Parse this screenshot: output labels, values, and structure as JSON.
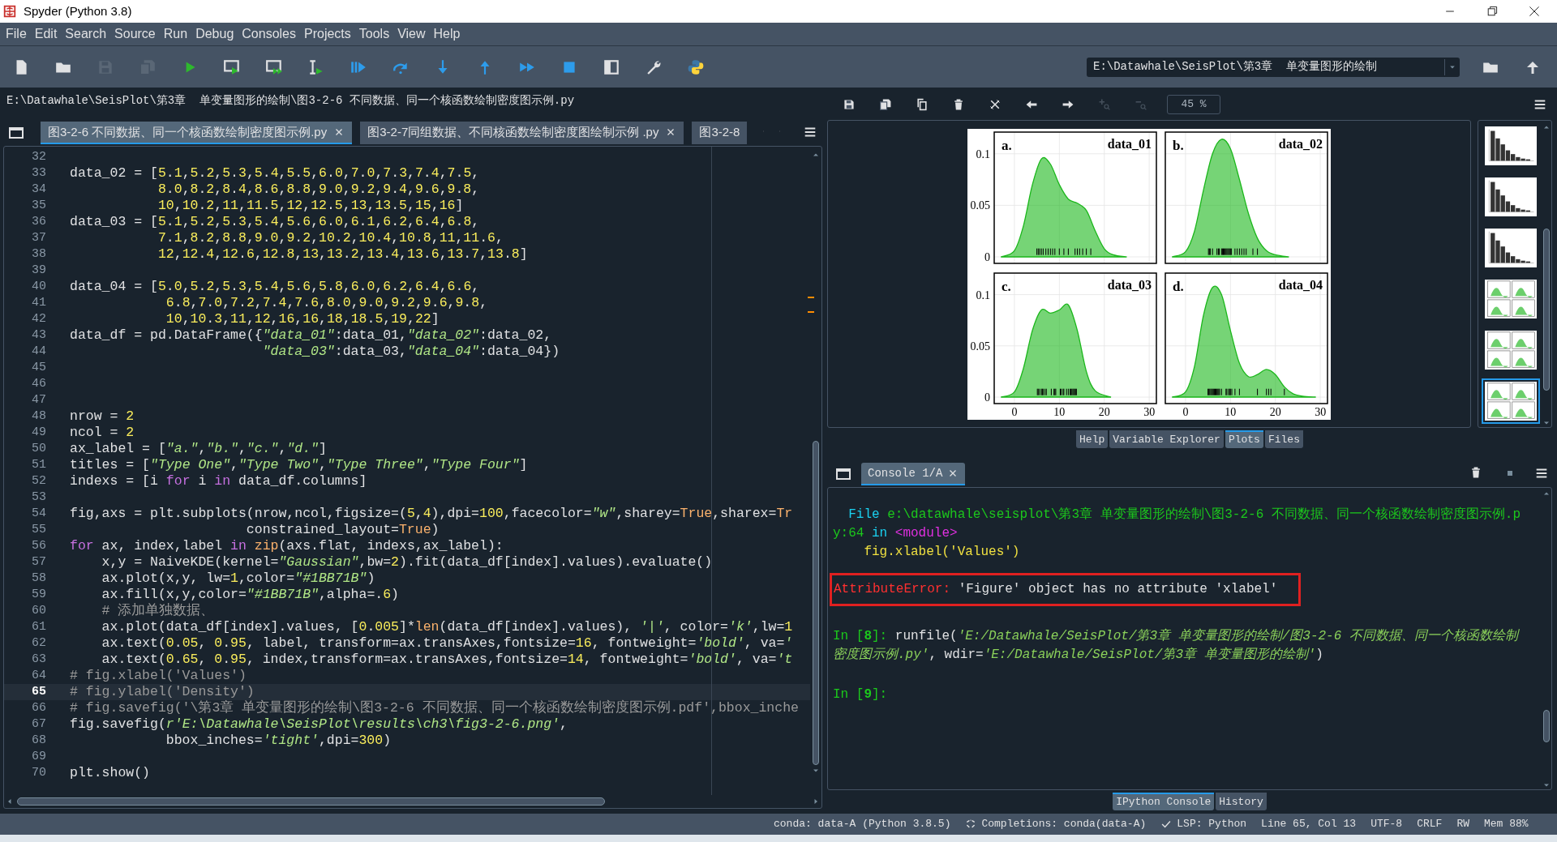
{
  "window": {
    "title": "Spyder (Python 3.8)"
  },
  "menu": [
    "File",
    "Edit",
    "Search",
    "Source",
    "Run",
    "Debug",
    "Consoles",
    "Projects",
    "Tools",
    "View",
    "Help"
  ],
  "toolbar": [
    {
      "kind": "new",
      "disabled": false
    },
    {
      "kind": "open",
      "disabled": false
    },
    {
      "kind": "save",
      "disabled": true
    },
    {
      "kind": "saveall",
      "disabled": true
    },
    {
      "kind": "run",
      "disabled": false
    },
    {
      "kind": "runcell",
      "disabled": false
    },
    {
      "kind": "runcelladvance",
      "disabled": false
    },
    {
      "kind": "runselection",
      "disabled": false
    },
    {
      "kind": "debug",
      "disabled": false
    },
    {
      "kind": "stepover",
      "disabled": false
    },
    {
      "kind": "stepinto",
      "disabled": false
    },
    {
      "kind": "stepout",
      "disabled": false
    },
    {
      "kind": "continue",
      "disabled": false
    },
    {
      "kind": "stop",
      "disabled": false
    },
    {
      "kind": "maximize",
      "disabled": false
    },
    {
      "kind": "preferences",
      "disabled": false
    },
    {
      "kind": "python",
      "disabled": false
    }
  ],
  "working_directory": "E:\\Datawhale\\SeisPlot\\第3章  单变量图形的绘制",
  "editor": {
    "path": "E:\\Datawhale\\SeisPlot\\第3章  单变量图形的绘制\\图3-2-6 不同数据、同一个核函数绘制密度图示例.py",
    "tabs": [
      {
        "label": "图3-2-6 不同数据、同一个核函数绘制密度图示例.py",
        "selected": true,
        "closable": true
      },
      {
        "label": "图3-2-7同组数据、不同核函数绘制密度图绘制示例 .py",
        "selected": false,
        "closable": true
      },
      {
        "label": "图3-2-8",
        "selected": false,
        "closable": false
      }
    ],
    "lines": [
      {
        "number": "32",
        "current": false
      },
      {
        "number": "33",
        "current": false,
        "tokens": [
          {
            "kind": "plain",
            "text": "data_02 = "
          },
          {
            "kind": "nums",
            "text": "[5.1,5.2,5.3,5.4,5.5,6.0,7.0,7.3,7.4,7.5,"
          }
        ]
      },
      {
        "number": "34",
        "current": false,
        "tokens": [
          {
            "kind": "nums",
            "text": "           8.0,8.2,8.4,8.6,8.8,9.0,9.2,9.4,9.6,9.8,"
          }
        ]
      },
      {
        "number": "35",
        "current": false,
        "tokens": [
          {
            "kind": "nums",
            "text": "           10,10.2,11,11.5,12,12.5,13,13.5,15,16]"
          }
        ]
      },
      {
        "number": "36",
        "current": false,
        "tokens": [
          {
            "kind": "plain",
            "text": "data_03 = "
          },
          {
            "kind": "nums",
            "text": "[5.1,5.2,5.3,5.4,5.6,6.0,6.1,6.2,6.4,6.8,"
          }
        ]
      },
      {
        "number": "37",
        "current": false,
        "tokens": [
          {
            "kind": "nums",
            "text": "           7.1,8.2,8.8,9.0,9.2,10.2,10.4,10.8,11,11.6,"
          }
        ]
      },
      {
        "number": "38",
        "current": false,
        "tokens": [
          {
            "kind": "nums",
            "text": "           12,12.4,12.6,12.8,13,13.2,13.4,13.6,13.7,13.8]"
          }
        ]
      },
      {
        "number": "39",
        "current": false
      },
      {
        "number": "40",
        "current": false,
        "tokens": [
          {
            "kind": "plain",
            "text": "data_04 = "
          },
          {
            "kind": "nums",
            "text": "[5.0,5.2,5.3,5.4,5.6,5.8,6.0,6.2,6.4,6.6,"
          }
        ]
      },
      {
        "number": "41",
        "current": false,
        "tokens": [
          {
            "kind": "nums",
            "text": "            6.8,7.0,7.2,7.4,7.6,8.0,9.0,9.2,9.6,9.8,"
          }
        ]
      },
      {
        "number": "42",
        "current": false,
        "tokens": [
          {
            "kind": "nums",
            "text": "            10,10.3,11,12,16,16,18,18.5,19,22]"
          }
        ]
      },
      {
        "number": "43",
        "current": false,
        "tokens": [
          {
            "kind": "plain",
            "text": "data_df = pd.DataFrame({"
          },
          {
            "kind": "str",
            "text": "\"data_01\""
          },
          {
            "kind": "plain",
            "text": ":data_01,"
          },
          {
            "kind": "str",
            "text": "\"data_02\""
          },
          {
            "kind": "plain",
            "text": ":data_02,"
          }
        ]
      },
      {
        "number": "44",
        "current": false,
        "tokens": [
          {
            "kind": "str",
            "text": "                        \"data_03\""
          },
          {
            "kind": "plain",
            "text": ":data_03,"
          },
          {
            "kind": "str",
            "text": "\"data_04\""
          },
          {
            "kind": "plain",
            "text": ":data_04})"
          }
        ]
      },
      {
        "number": "45",
        "current": false
      },
      {
        "number": "46",
        "current": false
      },
      {
        "number": "47",
        "current": false
      },
      {
        "number": "48",
        "current": false,
        "tokens": [
          {
            "kind": "plain",
            "text": "nrow = "
          },
          {
            "kind": "nums",
            "text": "2"
          }
        ]
      },
      {
        "number": "49",
        "current": false,
        "tokens": [
          {
            "kind": "plain",
            "text": "ncol = "
          },
          {
            "kind": "nums",
            "text": "2"
          }
        ]
      },
      {
        "number": "50",
        "current": false,
        "tokens": [
          {
            "kind": "plain",
            "text": "ax_label = ["
          },
          {
            "kind": "str",
            "text": "\"a.\""
          },
          {
            "kind": "plain",
            "text": ","
          },
          {
            "kind": "str",
            "text": "\"b.\""
          },
          {
            "kind": "plain",
            "text": ","
          },
          {
            "kind": "str",
            "text": "\"c.\""
          },
          {
            "kind": "plain",
            "text": ","
          },
          {
            "kind": "str",
            "text": "\"d.\""
          },
          {
            "kind": "plain",
            "text": "]"
          }
        ]
      },
      {
        "number": "51",
        "current": false,
        "tokens": [
          {
            "kind": "plain",
            "text": "titles = ["
          },
          {
            "kind": "str",
            "text": "\"Type One\""
          },
          {
            "kind": "plain",
            "text": ","
          },
          {
            "kind": "str",
            "text": "\"Type Two\""
          },
          {
            "kind": "plain",
            "text": ","
          },
          {
            "kind": "str",
            "text": "\"Type Three\""
          },
          {
            "kind": "plain",
            "text": ","
          },
          {
            "kind": "str",
            "text": "\"Type Four\""
          },
          {
            "kind": "plain",
            "text": "]"
          }
        ]
      },
      {
        "number": "52",
        "current": false,
        "tokens": [
          {
            "kind": "plain",
            "text": "indexs = [i "
          },
          {
            "kind": "kw",
            "text": "for"
          },
          {
            "kind": "plain",
            "text": " i "
          },
          {
            "kind": "kw",
            "text": "in"
          },
          {
            "kind": "plain",
            "text": " data_df.columns]"
          }
        ]
      },
      {
        "number": "53",
        "current": false
      },
      {
        "number": "54",
        "current": false,
        "tokens": [
          {
            "kind": "plain",
            "text": "fig,axs = plt.subplots(nrow,ncol,figsize="
          },
          {
            "kind": "nums",
            "text": "(5,4),dpi=100,facecolor="
          },
          {
            "kind": "str",
            "text": "\"w\""
          },
          {
            "kind": "plain",
            "text": ",sharey="
          },
          {
            "kind": "builtin",
            "text": "True"
          },
          {
            "kind": "plain",
            "text": ",sharex="
          },
          {
            "kind": "builtin",
            "text": "Tr"
          }
        ]
      },
      {
        "number": "55",
        "current": false,
        "tokens": [
          {
            "kind": "plain",
            "text": "                      constrained_layout="
          },
          {
            "kind": "builtin",
            "text": "True"
          },
          {
            "kind": "plain",
            "text": ")"
          }
        ]
      },
      {
        "number": "56",
        "current": false,
        "tokens": [
          {
            "kind": "kw",
            "text": "for"
          },
          {
            "kind": "plain",
            "text": " ax, index,label "
          },
          {
            "kind": "kw",
            "text": "in"
          },
          {
            "kind": "builtin",
            "text": " zip"
          },
          {
            "kind": "plain",
            "text": "(axs.flat, indexs,ax_label):"
          }
        ]
      },
      {
        "number": "57",
        "current": false,
        "tokens": [
          {
            "kind": "plain",
            "text": "    x,y = NaiveKDE(kernel="
          },
          {
            "kind": "str",
            "text": "\"Gaussian\""
          },
          {
            "kind": "nums",
            "text": ",bw=2).fit(data_df[index].values).evaluate()"
          }
        ]
      },
      {
        "number": "58",
        "current": false,
        "tokens": [
          {
            "kind": "nums",
            "text": "    ax.plot(x,y, lw=1,color="
          },
          {
            "kind": "str",
            "text": "\"#1BB71B\""
          },
          {
            "kind": "plain",
            "text": ")"
          }
        ]
      },
      {
        "number": "59",
        "current": false,
        "tokens": [
          {
            "kind": "plain",
            "text": "    ax.fill(x,y,color="
          },
          {
            "kind": "str",
            "text": "\"#1BB71B\""
          },
          {
            "kind": "nums",
            "text": ",alpha=.6)"
          }
        ]
      },
      {
        "number": "60",
        "current": false,
        "tokens": [
          {
            "kind": "comment",
            "text": "    # 添加单独数据、"
          }
        ]
      },
      {
        "number": "61",
        "current": false,
        "tokens": [
          {
            "kind": "plain",
            "text": "    ax.plot(data_df[index].values, ["
          },
          {
            "kind": "nums",
            "text": "0.005"
          },
          {
            "kind": "plain",
            "text": "]*"
          },
          {
            "kind": "builtin",
            "text": "len"
          },
          {
            "kind": "plain",
            "text": "(data_df[index].values), "
          },
          {
            "kind": "str",
            "text": "'|'"
          },
          {
            "kind": "plain",
            "text": ", color="
          },
          {
            "kind": "str",
            "text": "'k'"
          },
          {
            "kind": "nums",
            "text": ",lw=1"
          }
        ]
      },
      {
        "number": "62",
        "current": false,
        "tokens": [
          {
            "kind": "nums",
            "text": "    ax.text(0.05, 0.95, label, transform=ax.transAxes,fontsize=16, fontweight="
          },
          {
            "kind": "str",
            "text": "'bold'"
          },
          {
            "kind": "plain",
            "text": ", va="
          },
          {
            "kind": "str",
            "text": "'"
          }
        ]
      },
      {
        "number": "63",
        "current": false,
        "tokens": [
          {
            "kind": "nums",
            "text": "    ax.text(0.65, 0.95, index,transform=ax.transAxes,fontsize=14, fontweight="
          },
          {
            "kind": "str",
            "text": "'bold'"
          },
          {
            "kind": "plain",
            "text": ", va="
          },
          {
            "kind": "str",
            "text": "'t"
          }
        ]
      },
      {
        "number": "64",
        "current": false,
        "tokens": [
          {
            "kind": "comment",
            "text": "# fig.xlabel('Values')"
          }
        ]
      },
      {
        "number": "65",
        "current": true,
        "tokens": [
          {
            "kind": "comment",
            "text": "# fig.ylabel('Density')"
          }
        ]
      },
      {
        "number": "66",
        "current": false,
        "tokens": [
          {
            "kind": "comment",
            "text": "# fig.savefig('\\第3章 单变量图形的绘制\\图3-2-6 不同数据、同一个核函数绘制密度图示例.pdf',bbox_inche"
          }
        ]
      },
      {
        "number": "67",
        "current": false,
        "tokens": [
          {
            "kind": "plain",
            "text": "fig.savefig("
          },
          {
            "kind": "str",
            "text": "r'E:\\Datawhale\\SeisPlot\\results\\ch3\\fig3-2-6.png'"
          },
          {
            "kind": "plain",
            "text": ","
          }
        ]
      },
      {
        "number": "68",
        "current": false,
        "tokens": [
          {
            "kind": "plain",
            "text": "            bbox_inches="
          },
          {
            "kind": "str",
            "text": "'tight'"
          },
          {
            "kind": "nums",
            "text": ",dpi=300)"
          }
        ]
      },
      {
        "number": "69",
        "current": false
      },
      {
        "number": "70",
        "current": false,
        "tokens": [
          {
            "kind": "plain",
            "text": "plt.show()"
          }
        ]
      }
    ]
  },
  "plots": {
    "toolbar": [
      {
        "kind": "save",
        "disabled": false
      },
      {
        "kind": "saveall",
        "disabled": false
      },
      {
        "kind": "copy",
        "disabled": false
      },
      {
        "kind": "trash",
        "disabled": false
      },
      {
        "kind": "closeall",
        "disabled": false
      },
      {
        "kind": "back",
        "disabled": false
      },
      {
        "kind": "forward",
        "disabled": false
      },
      {
        "kind": "zoomin",
        "disabled": true
      },
      {
        "kind": "zoomout",
        "disabled": true
      }
    ],
    "zoom": "45 %",
    "subplots": [
      {
        "label": "a.",
        "chart_data": {
          "type": "area",
          "title": "data_01",
          "x": [
            -3,
            0,
            2,
            4,
            6,
            8,
            10,
            12,
            14,
            16,
            18,
            20,
            22,
            25
          ],
          "series": [
            {
              "color": "#1bb71b",
              "values": [
                0,
                0.006,
                0.03,
                0.07,
                0.095,
                0.09,
                0.07,
                0.056,
                0.052,
                0.045,
                0.025,
                0.008,
                0.002,
                0
              ]
            }
          ],
          "xlim": [
            -4.5,
            31.6
          ],
          "ylim": [
            -0.0063,
            0.121
          ],
          "yticks": [
            {
              "value": 0,
              "label": "0"
            },
            {
              "value": 0.05,
              "label": "0.05"
            },
            {
              "value": 0.1,
              "label": "0.1"
            }
          ],
          "grid": true
        }
      },
      {
        "label": "b.",
        "chart_data": {
          "type": "area",
          "title": "data_02",
          "x": [
            -3,
            0,
            2,
            4,
            6,
            8,
            10,
            12,
            14,
            16,
            18,
            20,
            23
          ],
          "series": [
            {
              "color": "#1bb71b",
              "values": [
                0,
                0.005,
                0.025,
                0.065,
                0.1,
                0.114,
                0.105,
                0.075,
                0.042,
                0.018,
                0.006,
                0.002,
                0
              ]
            }
          ],
          "xlim": [
            -4.5,
            31.6
          ],
          "ylim": [
            -0.0063,
            0.121
          ],
          "grid": true
        }
      },
      {
        "label": "c.",
        "chart_data": {
          "type": "area",
          "title": "data_03",
          "x": [
            -3,
            0,
            2,
            4,
            6,
            8,
            10,
            12,
            14,
            16,
            18,
            21.5
          ],
          "series": [
            {
              "color": "#1bb71b",
              "values": [
                0,
                0.005,
                0.028,
                0.065,
                0.085,
                0.082,
                0.085,
                0.09,
                0.065,
                0.025,
                0.006,
                0
              ]
            }
          ],
          "xlim": [
            -4.5,
            31.6
          ],
          "ylim": [
            -0.0063,
            0.121
          ],
          "xticks": [
            0,
            10,
            20,
            30
          ],
          "yticks": [
            {
              "value": 0,
              "label": "0"
            },
            {
              "value": 0.05,
              "label": "0.05"
            },
            {
              "value": 0.1,
              "label": "0.1"
            }
          ],
          "grid": true
        }
      },
      {
        "label": "d.",
        "chart_data": {
          "type": "area",
          "title": "data_04",
          "x": [
            -3,
            0,
            2,
            4,
            6,
            8,
            10,
            12,
            14,
            16,
            18,
            20,
            22,
            24,
            26,
            29
          ],
          "series": [
            {
              "color": "#1bb71b",
              "values": [
                0,
                0.005,
                0.03,
                0.08,
                0.107,
                0.1,
                0.065,
                0.033,
                0.02,
                0.022,
                0.027,
                0.022,
                0.01,
                0.003,
                0.001,
                0
              ]
            }
          ],
          "xlim": [
            -4.5,
            31.6
          ],
          "ylim": [
            -0.0063,
            0.121
          ],
          "xticks": [
            0,
            10,
            20,
            30
          ],
          "grid": true
        }
      }
    ],
    "thumbnails": [
      {
        "kind": "histogram",
        "selected": false
      },
      {
        "kind": "histogram",
        "selected": false
      },
      {
        "kind": "histogram",
        "selected": false
      },
      {
        "kind": "density",
        "selected": false
      },
      {
        "kind": "density",
        "selected": false
      },
      {
        "kind": "density",
        "selected": true
      }
    ],
    "pane_tabs": [
      {
        "label": "Help",
        "selected": false
      },
      {
        "label": "Variable Explorer",
        "selected": false
      },
      {
        "label": "Plots",
        "selected": true
      },
      {
        "label": "Files",
        "selected": false
      }
    ]
  },
  "console": {
    "tab": "Console 1/A",
    "lines": [
      {
        "kind": "traceback",
        "segments": [
          {
            "kind": "file",
            "text": "  File "
          },
          {
            "kind": "path",
            "text": "e:\\datawhale\\seisplot\\第3章 单变量图形的绘制\\图3-2-6 不同数据、同一个核函数绘制密度图示例.py:64"
          },
          {
            "kind": "keyword",
            "text": " in "
          },
          {
            "kind": "module",
            "text": "<module>"
          }
        ]
      },
      {
        "kind": "source",
        "segments": [
          {
            "kind": "code",
            "text": "    fig.xlabel('Values')"
          }
        ]
      },
      {
        "kind": "error",
        "segments": [
          {
            "kind": "error",
            "text": "AttributeError: "
          },
          {
            "kind": "plain",
            "text": "'Figure' object has no attribute 'xlabel'"
          }
        ]
      },
      {
        "kind": "input",
        "segments": [
          {
            "kind": "prompt",
            "text": "In ["
          },
          {
            "kind": "prompt-number",
            "text": "8"
          },
          {
            "kind": "prompt",
            "text": "]: "
          },
          {
            "kind": "plain",
            "text": "runfile("
          },
          {
            "kind": "string",
            "text": "'E:/Datawhale/SeisPlot/第3章 单变量图形的绘制/图3-2-6 不同数据、同一个核函数绘制密度图示例.py'"
          },
          {
            "kind": "plain",
            "text": ", wdir="
          },
          {
            "kind": "string",
            "text": "'E:/Datawhale/SeisPlot/第3章 单变量图形的绘制'"
          },
          {
            "kind": "plain",
            "text": ")"
          }
        ]
      },
      {
        "kind": "input",
        "segments": [
          {
            "kind": "prompt",
            "text": "In ["
          },
          {
            "kind": "prompt-number",
            "text": "9"
          },
          {
            "kind": "prompt",
            "text": "]:"
          }
        ]
      }
    ],
    "pane_tabs": [
      {
        "label": "IPython Console",
        "selected": true
      },
      {
        "label": "History",
        "selected": false
      }
    ]
  },
  "status_bar": [
    {
      "kind": "env",
      "text": "conda: data-A (Python 3.8.5)"
    },
    {
      "kind": "completions",
      "text": "Completions: conda(data-A)"
    },
    {
      "kind": "lsp",
      "text": "LSP: Python"
    },
    {
      "kind": "cursor",
      "text": "Line 65, Col 13"
    },
    {
      "kind": "encoding",
      "text": "UTF-8"
    },
    {
      "kind": "eol",
      "text": "CRLF"
    },
    {
      "kind": "permissions",
      "text": "RW"
    },
    {
      "kind": "memory",
      "text": "Mem 88%"
    }
  ]
}
